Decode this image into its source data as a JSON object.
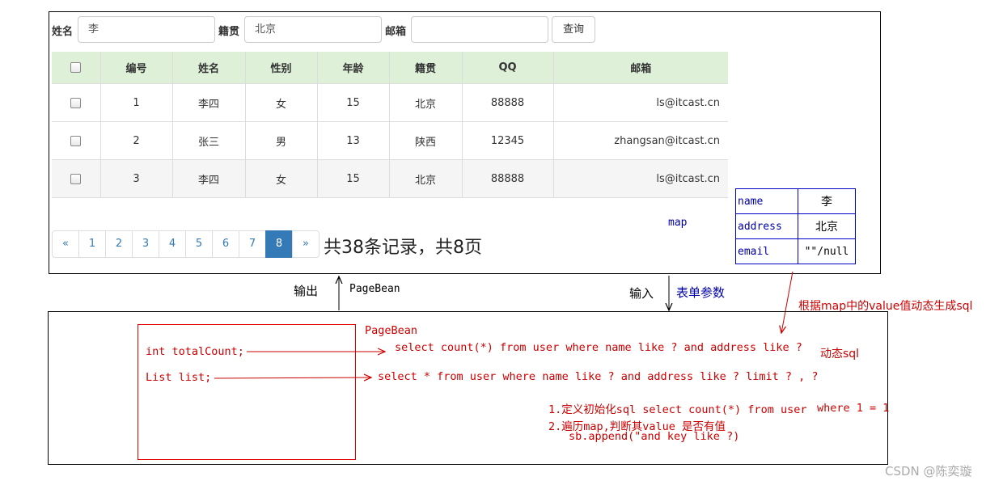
{
  "search": {
    "name_label": "姓名",
    "name_value": "李",
    "place_label": "籍贯",
    "place_value": "北京",
    "email_label": "邮箱",
    "email_value": "",
    "button": "查询"
  },
  "table": {
    "headers": [
      "编号",
      "姓名",
      "性别",
      "年龄",
      "籍贯",
      "QQ",
      "邮箱"
    ],
    "rows": [
      [
        "1",
        "李四",
        "女",
        "15",
        "北京",
        "88888",
        "ls@itcast.cn"
      ],
      [
        "2",
        "张三",
        "男",
        "13",
        "陕西",
        "12345",
        "zhangsan@itcast.cn"
      ],
      [
        "3",
        "李四",
        "女",
        "15",
        "北京",
        "88888",
        "ls@itcast.cn"
      ]
    ]
  },
  "pagination": {
    "prev": "«",
    "pages": [
      "1",
      "2",
      "3",
      "4",
      "5",
      "6",
      "7",
      "8"
    ],
    "active_page": "8",
    "next": "»",
    "summary": "共38条记录，共8页"
  },
  "map": {
    "label": "map",
    "entries": [
      {
        "key": "name",
        "value": "李"
      },
      {
        "key": "address",
        "value": "北京"
      },
      {
        "key": "email",
        "value": "\"\"/null"
      }
    ]
  },
  "arrows": {
    "output": "输出",
    "pagebean_out": "PageBean",
    "input": "输入",
    "form_params": "表单参数",
    "dynamic_note": "根据map中的value值动态生成sql"
  },
  "pagebean": {
    "title": "PageBean",
    "field1": "int totalCount;",
    "field2": "List list;"
  },
  "sql": {
    "count_sql": "select count(*) from user where name like ? and address like ?",
    "list_sql": "select * from user where name like ? and address like ? limit ? , ?",
    "dynamic_label": "动态sql",
    "step1": "1.定义初始化sql select count(*) from user",
    "step1_where": "where 1 = 1",
    "step2": "2.遍历map,判断其value 是否有值",
    "step2_code": "sb.append(\"and  key like ?)"
  },
  "watermark": "CSDN @陈奕璇",
  "colors": {
    "header_bg": "#dff0d8",
    "active_page": "#337ab7",
    "diagram_red": "#cc0000",
    "map_blue": "#0000cc"
  }
}
